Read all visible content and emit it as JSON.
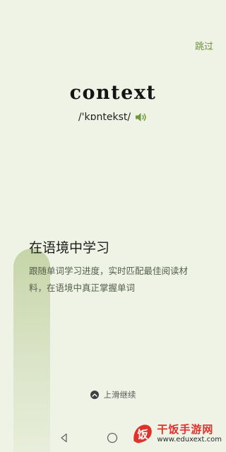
{
  "header": {
    "skip_label": "跳过"
  },
  "word": {
    "text": "context",
    "phonetic": "/'kɒntekst/",
    "speaker_icon": "speaker-icon"
  },
  "intro": {
    "title": "在语境中学习",
    "description": "跟随单词学习进度，实时匹配最佳阅读材料，在语境中真正掌握单词"
  },
  "footer": {
    "swipe_label": "上滑继续",
    "swipe_icon": "chevron-up-icon"
  },
  "navbar": {
    "icons": [
      "back-icon",
      "home-icon"
    ]
  },
  "watermark": {
    "logo_glyph": "饭",
    "name": "干饭手游网",
    "url": "www.eduxext.com"
  },
  "colors": {
    "background": "#eff3e6",
    "accent_green": "#6f8f3f",
    "watermark_red": "#e0322d"
  }
}
